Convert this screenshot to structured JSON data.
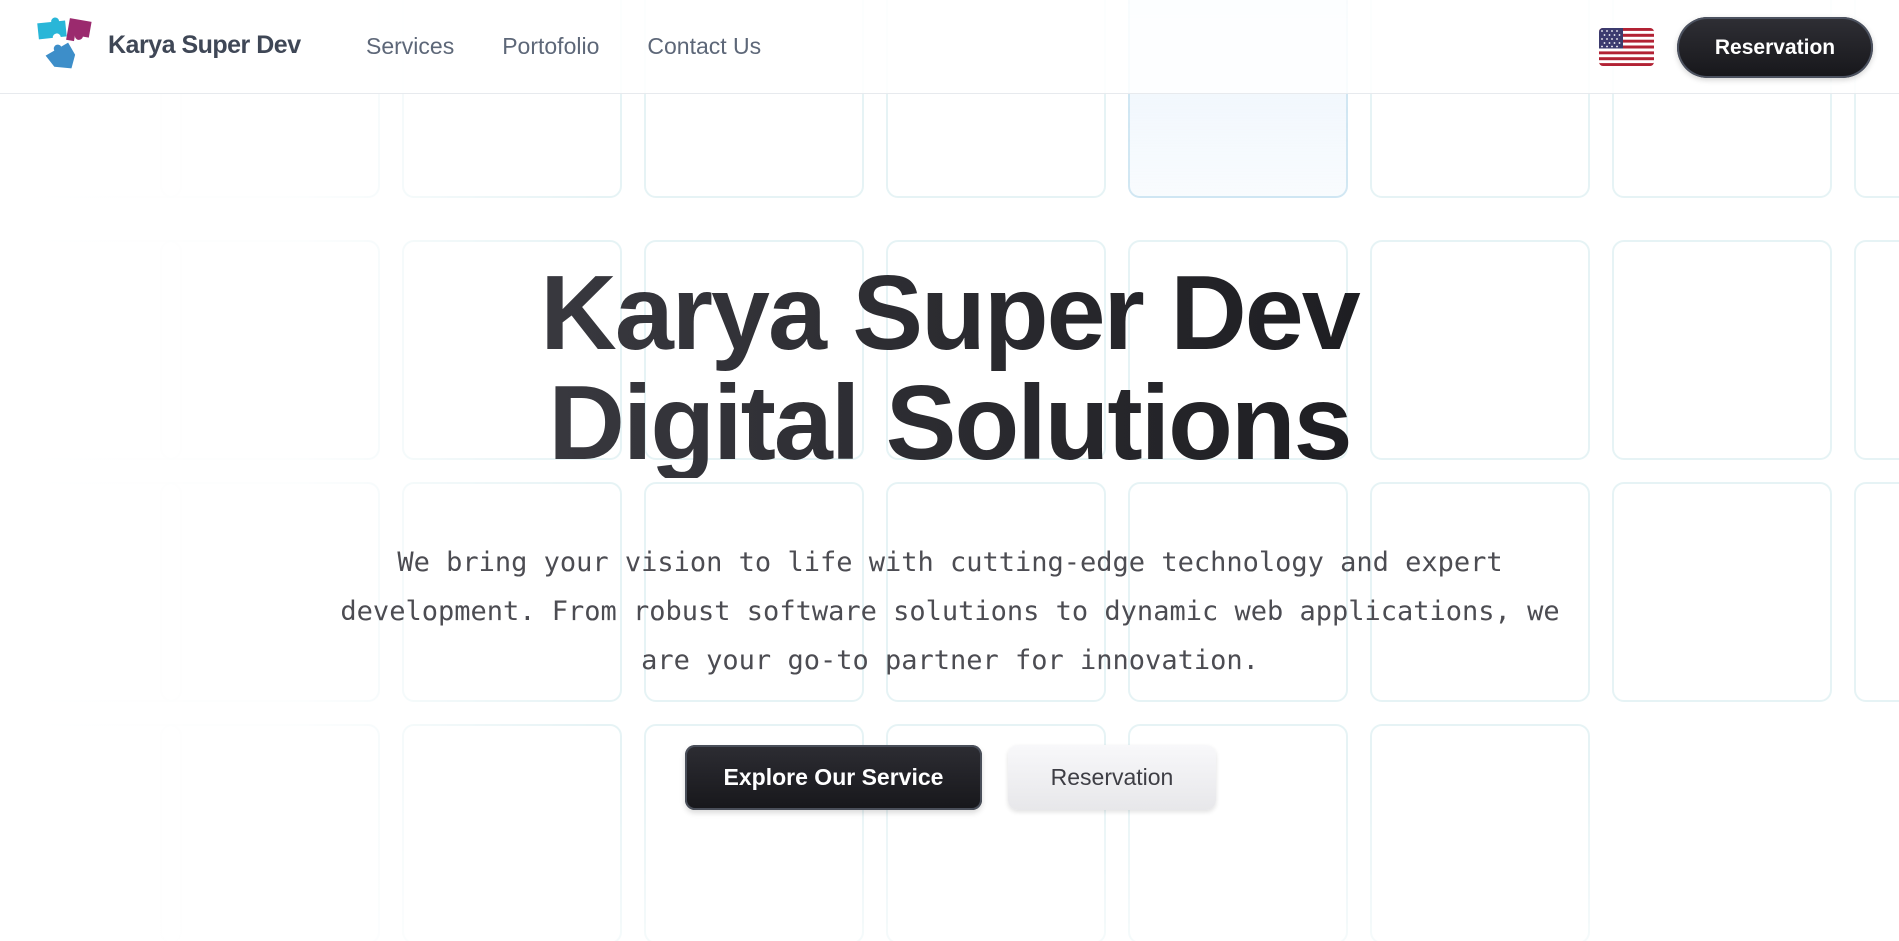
{
  "header": {
    "brand": "Karya Super Dev",
    "nav": [
      {
        "label": "Services"
      },
      {
        "label": "Portofolio"
      },
      {
        "label": "Contact Us"
      }
    ],
    "language_flag": "us-flag-icon",
    "reservation_label": "Reservation"
  },
  "hero": {
    "title_line1": "Karya Super Dev",
    "title_line2": "Digital Solutions",
    "description": "We bring your vision to life with cutting-edge technology and expert development. From robust software solutions to dynamic web applications, we are your go-to partner for innovation.",
    "primary_button": "Explore Our Service",
    "secondary_button": "Reservation"
  },
  "colors": {
    "logo_cyan": "#29b6d8",
    "logo_magenta": "#9b2a6e",
    "logo_blue": "#3d8ec9",
    "button_dark": "#1c1c21",
    "nav_text": "#5d6778"
  }
}
